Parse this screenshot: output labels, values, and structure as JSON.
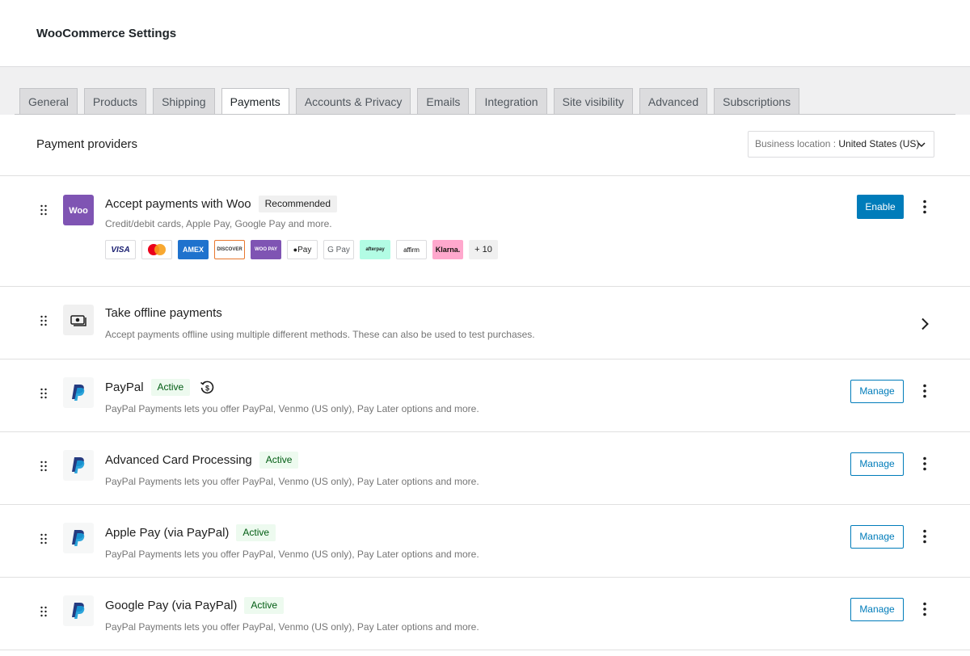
{
  "page_title": "WooCommerce Settings",
  "tabs": [
    {
      "label": "General"
    },
    {
      "label": "Products"
    },
    {
      "label": "Shipping"
    },
    {
      "label": "Payments",
      "active": true
    },
    {
      "label": "Accounts & Privacy"
    },
    {
      "label": "Emails"
    },
    {
      "label": "Integration"
    },
    {
      "label": "Site visibility"
    },
    {
      "label": "Advanced"
    },
    {
      "label": "Subscriptions"
    }
  ],
  "panel": {
    "title": "Payment providers",
    "location_label": "Business location : ",
    "location_value": "United States (US)"
  },
  "woo": {
    "title": "Accept payments with Woo",
    "badge": "Recommended",
    "description": "Credit/debit cards, Apple Pay, Google Pay and more.",
    "enable_label": "Enable",
    "methods": [
      "VISA",
      "mastercard",
      "AMEX",
      "DISCOVER",
      "WOO PAY",
      "Pay",
      "G Pay",
      "afterpay",
      "affirm",
      "Klarna."
    ],
    "more_label": "+ 10"
  },
  "offline": {
    "title": "Take offline payments",
    "description": "Accept payments offline using multiple different methods. These can also be used to test purchases."
  },
  "providers": [
    {
      "title": "PayPal",
      "badge": "Active",
      "description": "PayPal Payments lets you offer PayPal, Venmo (US only), Pay Later options and more.",
      "manage_label": "Manage"
    },
    {
      "title": "Advanced Card Processing",
      "badge": "Active",
      "description": "PayPal Payments lets you offer PayPal, Venmo (US only), Pay Later options and more.",
      "manage_label": "Manage"
    },
    {
      "title": "Apple Pay (via PayPal)",
      "badge": "Active",
      "description": "PayPal Payments lets you offer PayPal, Venmo (US only), Pay Later options and more.",
      "manage_label": "Manage"
    },
    {
      "title": "Google Pay (via PayPal)",
      "badge": "Active",
      "description": "PayPal Payments lets you offer PayPal, Venmo (US only), Pay Later options and more.",
      "manage_label": "Manage"
    }
  ],
  "colors": {
    "primary": "#007cba",
    "woo": "#7f54b3",
    "active_bg": "#edfaef",
    "paypal_dark": "#253b80",
    "paypal_light": "#179bd7"
  }
}
